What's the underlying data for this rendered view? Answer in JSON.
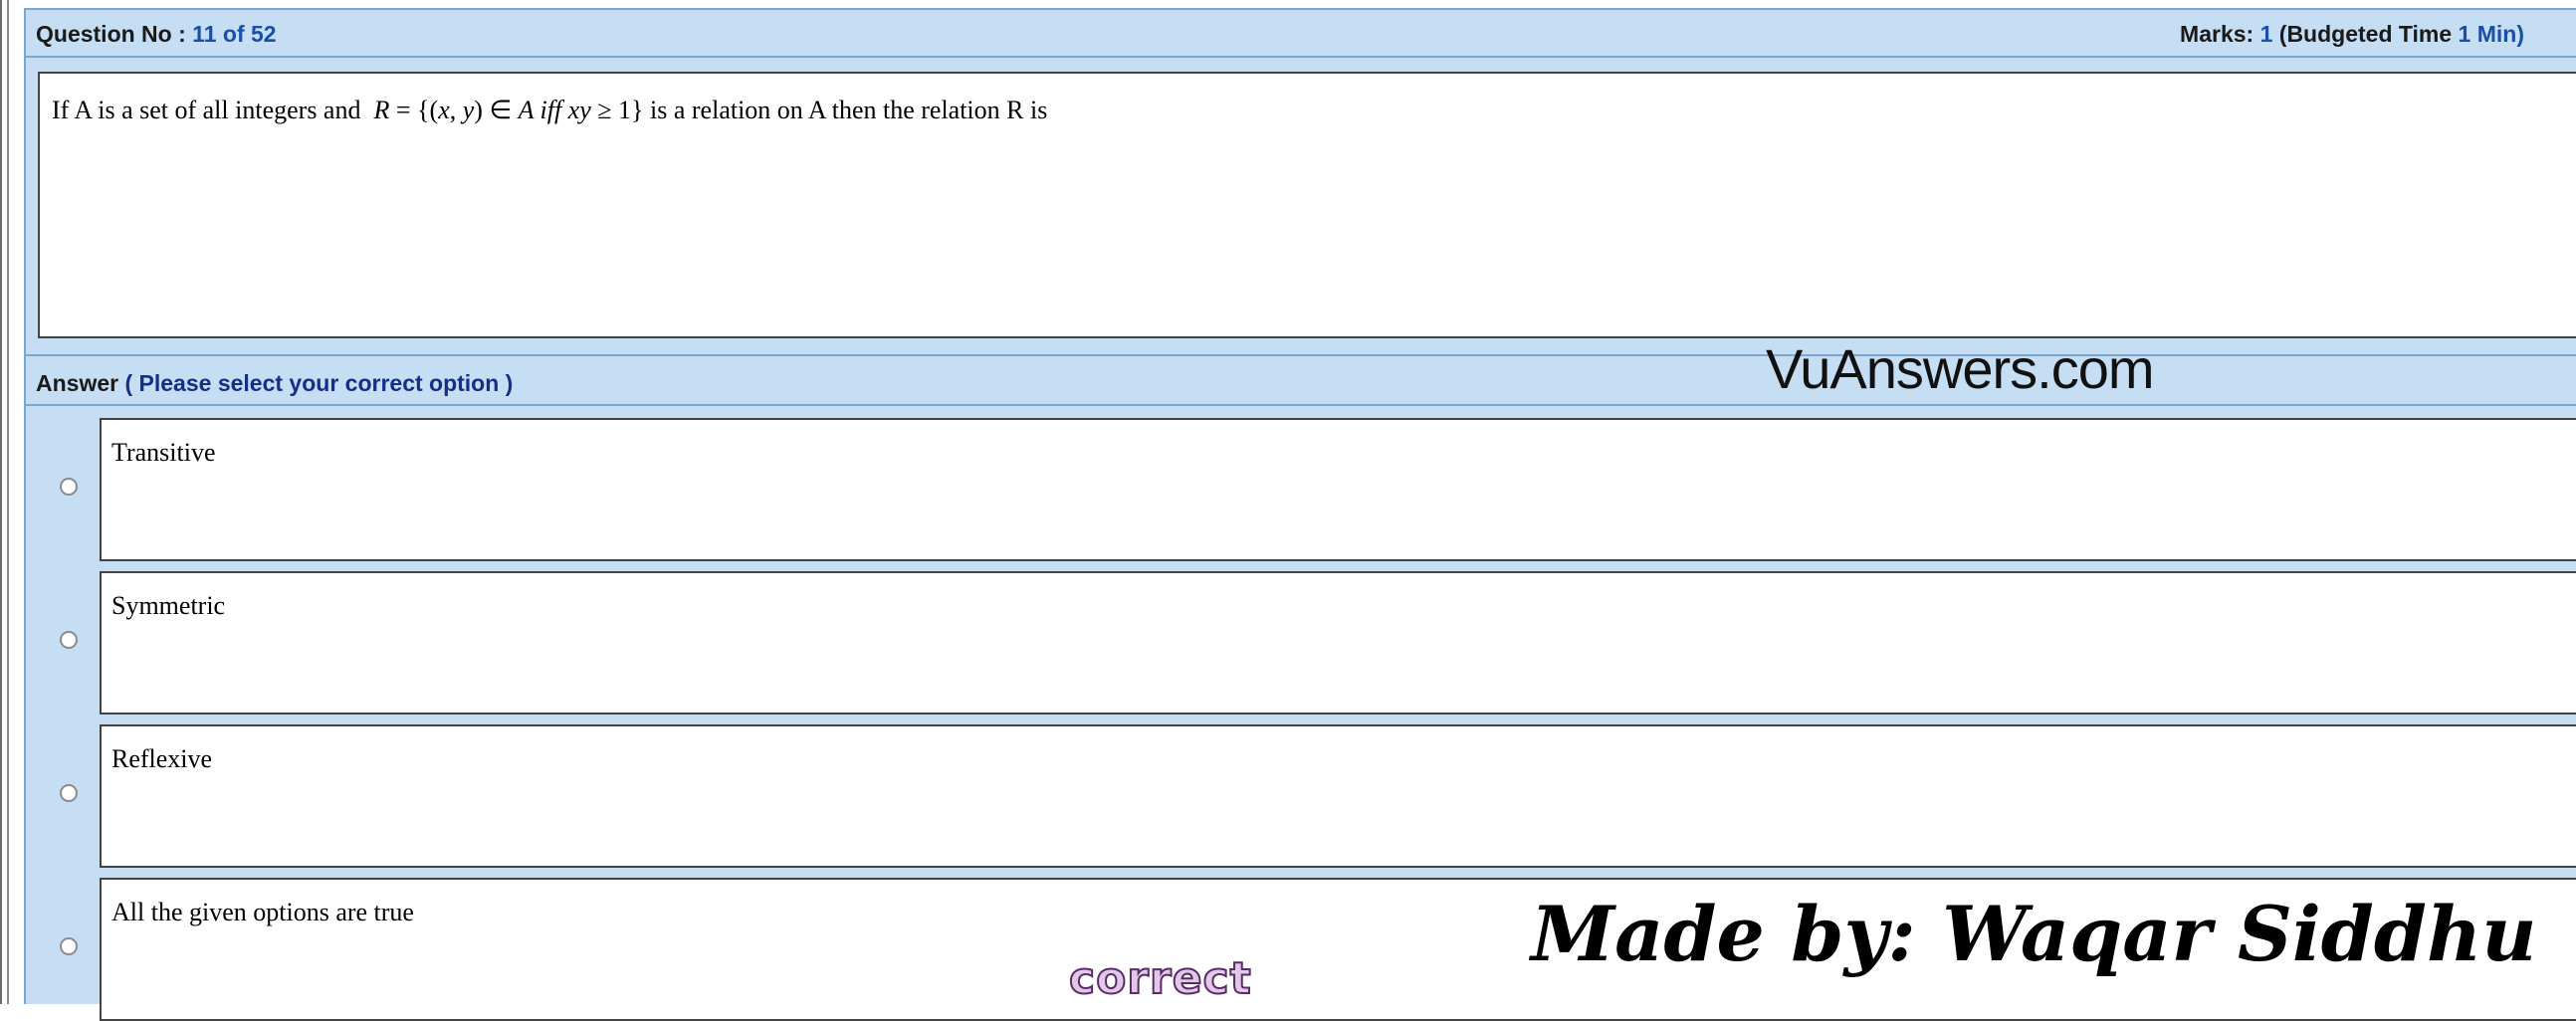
{
  "header": {
    "question_label": "Question No :",
    "question_number": "11",
    "of_label": "of",
    "total_questions": "52",
    "marks_label": "Marks:",
    "marks_value": "1",
    "budget_open": "(Budgeted Time",
    "budget_value": "1",
    "budget_unit": "Min)"
  },
  "question": {
    "part1": "If A is a set of all integers and",
    "formula_R": "R",
    "formula_eq": "= {(",
    "formula_x": "x",
    "formula_comma": ",",
    "formula_y": "y",
    "formula_in": ") ∈",
    "formula_A": "A iff xy",
    "formula_ge": "≥ 1}",
    "part2": "is a relation on A then the relation R is"
  },
  "answer": {
    "label": "Answer",
    "hint": "( Please select your correct option )"
  },
  "options": [
    {
      "label": "Transitive"
    },
    {
      "label": "Symmetric"
    },
    {
      "label": "Reflexive"
    },
    {
      "label": "All the given options are true"
    }
  ],
  "watermarks": {
    "site": "VuAnswers.com",
    "made_by": "Made by: Waqar Siddhu",
    "correct": "correct"
  },
  "colors": {
    "panel_bg": "#c6def3",
    "panel_border": "#7aa6d0",
    "accent_blue": "#1b4ea8",
    "hint_navy": "#152e8a"
  }
}
